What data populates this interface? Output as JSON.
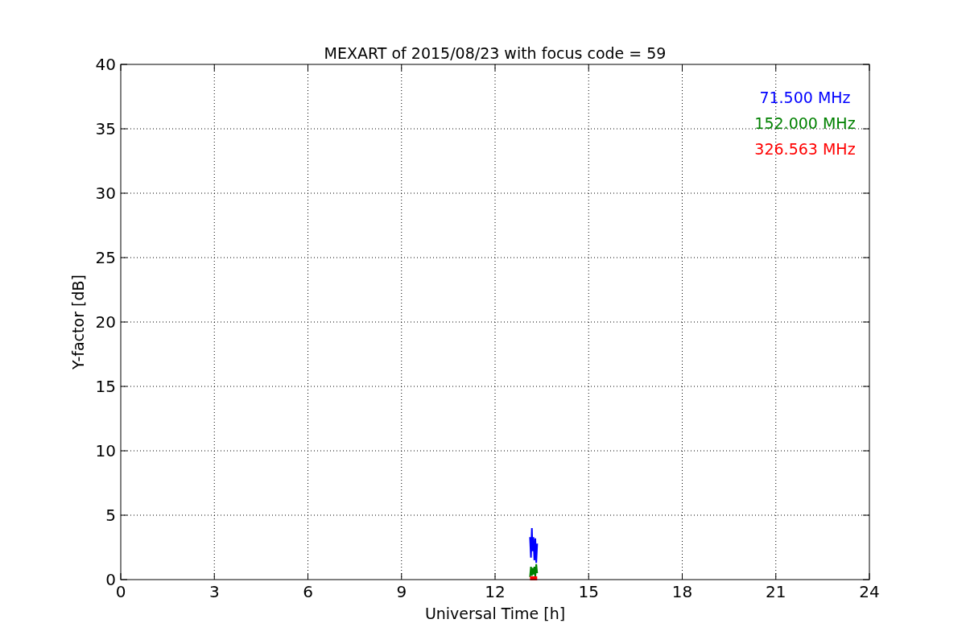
{
  "chart_data": {
    "type": "line",
    "title": "MEXART of 2015/08/23 with focus code = 59",
    "xlabel": "Universal Time [h]",
    "ylabel": "Y-factor [dB]",
    "x": [
      13.12,
      13.15,
      13.18,
      13.2,
      13.23,
      13.26,
      13.29,
      13.32,
      13.35
    ],
    "series": [
      {
        "name": "71.500 MHz",
        "color": "#0000ff",
        "values": [
          3.3,
          1.7,
          4.0,
          2.2,
          3.3,
          1.5,
          3.2,
          1.3,
          2.8
        ]
      },
      {
        "name": "152.000 MHz",
        "color": "#008000",
        "values": [
          0.2,
          1.0,
          0.3,
          0.9,
          0.4,
          1.0,
          0.2,
          1.2,
          0.5
        ]
      },
      {
        "name": "326.563 MHz",
        "color": "#ff0000",
        "values": [
          0.1,
          0.1,
          0.1,
          0.1,
          0.1,
          0.1,
          0.1,
          0.1,
          0.1
        ]
      }
    ],
    "xlim": [
      0,
      24
    ],
    "ylim": [
      0,
      40
    ],
    "xticks": [
      0,
      3,
      6,
      9,
      12,
      15,
      18,
      21,
      24
    ],
    "yticks": [
      0,
      5,
      10,
      15,
      20,
      25,
      30,
      35,
      40
    ],
    "grid": true
  }
}
